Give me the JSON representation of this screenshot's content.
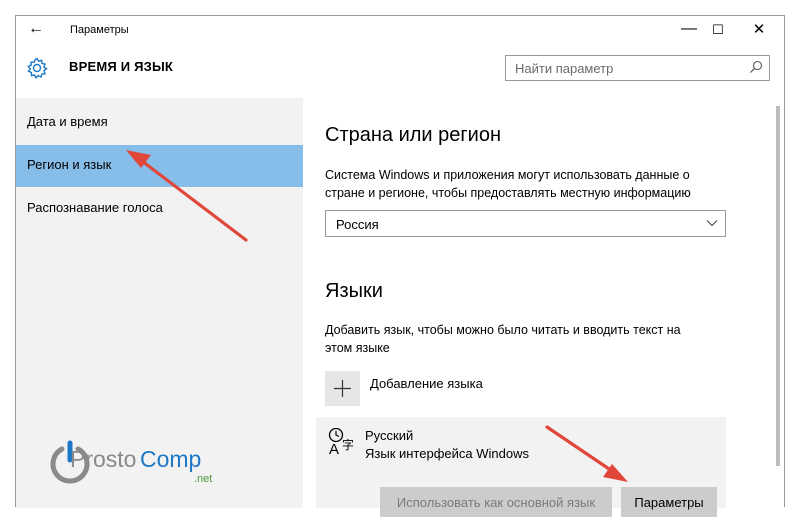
{
  "window": {
    "title": "Параметры",
    "controls": [
      "—",
      "☐",
      "✕"
    ]
  },
  "header": {
    "app_title": "ВРЕМЯ И ЯЗЫК",
    "search_placeholder": "Найти параметр"
  },
  "sidebar": {
    "items": [
      {
        "label": "Дата и время",
        "active": false
      },
      {
        "label": "Регион и язык",
        "active": true
      },
      {
        "label": "Распознавание голоса",
        "active": false
      }
    ]
  },
  "region": {
    "heading": "Страна или регион",
    "description_line1": "Система Windows и приложения могут использовать данные о",
    "description_line2": "стране и регионе, чтобы предоставлять местную информацию",
    "selected_country": "Россия"
  },
  "languages": {
    "heading": "Языки",
    "description_line1": "Добавить язык, чтобы можно было читать и вводить текст на",
    "description_line2": "этом языке",
    "add_label": "Добавление языка",
    "items": [
      {
        "name": "Русский",
        "subtitle": "Язык интерфейса Windows",
        "set_default_label": "Использовать как основной язык",
        "options_label": "Параметры"
      }
    ]
  },
  "watermark": {
    "text_prosto": "Prosto",
    "text_comp": "Comp",
    "text_net": ".net"
  },
  "colors": {
    "sidebar_bg": "#f2f2f2",
    "active_item": "#87bde9",
    "accent": "#1e78c8",
    "arrow": "#e0473a"
  }
}
